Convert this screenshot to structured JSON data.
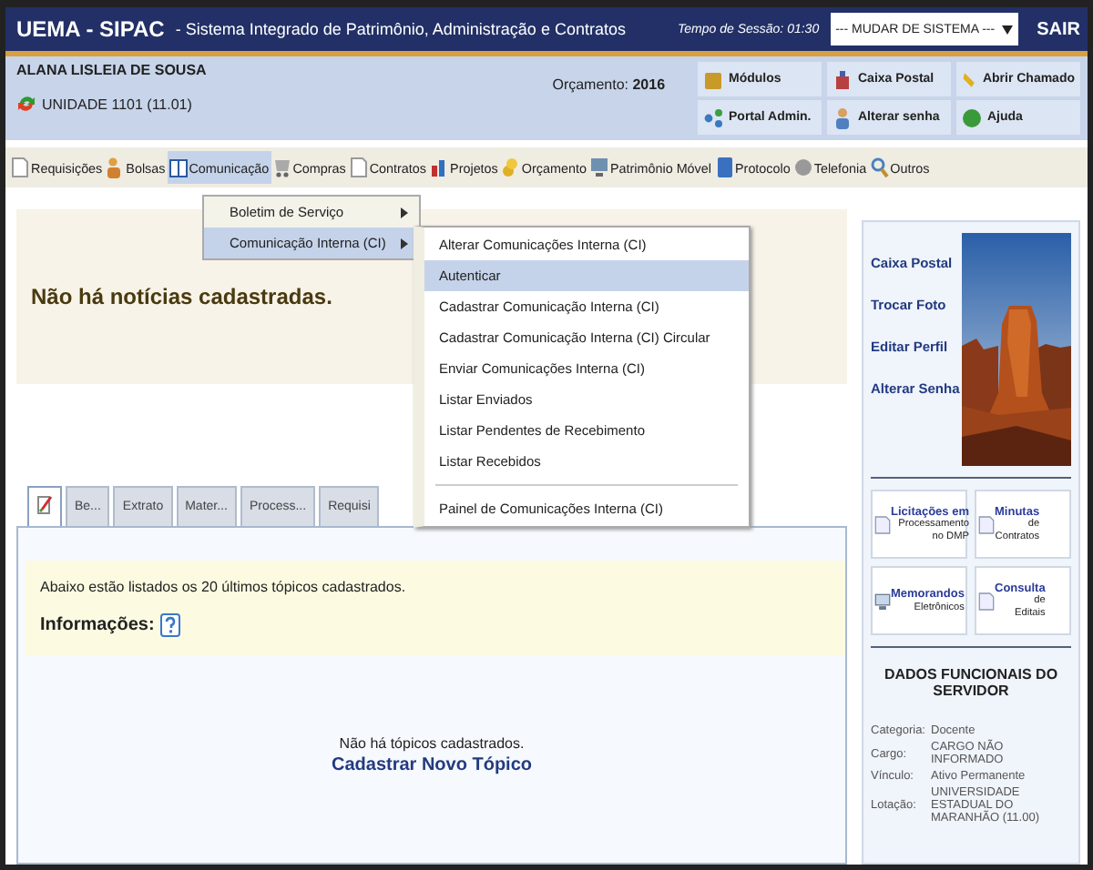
{
  "header": {
    "brand": "UEMA - SIPAC",
    "subtitle": "- Sistema Integrado de Patrimônio, Administração e Contratos",
    "session_label": "Tempo de Sessão:",
    "session_time": "01:30",
    "system_select": "--- MUDAR DE SISTEMA ---",
    "logout": "SAIR"
  },
  "user": {
    "name": "ALANA LISLEIA DE SOUSA",
    "unit": "UNIDADE 1101 (11.01)",
    "budget_label": "Orçamento:",
    "budget_year": "2016"
  },
  "quick_buttons": [
    {
      "label": "Módulos"
    },
    {
      "label": "Caixa Postal"
    },
    {
      "label": "Abrir Chamado"
    },
    {
      "label": "Portal Admin."
    },
    {
      "label": "Alterar senha"
    },
    {
      "label": "Ajuda"
    }
  ],
  "menu": [
    {
      "label": "Requisições",
      "selected": false
    },
    {
      "label": "Bolsas",
      "selected": false
    },
    {
      "label": "Comunicação",
      "selected": true
    },
    {
      "label": "Compras",
      "selected": false
    },
    {
      "label": "Contratos",
      "selected": false
    },
    {
      "label": "Projetos",
      "selected": false
    },
    {
      "label": "Orçamento",
      "selected": false
    },
    {
      "label": "Patrimônio Móvel",
      "selected": false
    },
    {
      "label": "Protocolo",
      "selected": false
    },
    {
      "label": "Telefonia",
      "selected": false
    },
    {
      "label": "Outros",
      "selected": false
    }
  ],
  "dropdown": [
    {
      "label": "Boletim de Serviço",
      "selected": false
    },
    {
      "label": "Comunicação Interna (CI)",
      "selected": true
    }
  ],
  "submenu": [
    {
      "label": "Alterar Comunicações Interna (CI)",
      "selected": false
    },
    {
      "label": "Autenticar",
      "selected": true
    },
    {
      "label": "Cadastrar Comunicação Interna (CI)",
      "selected": false
    },
    {
      "label": "Cadastrar Comunicação Interna (CI) Circular",
      "selected": false
    },
    {
      "label": "Enviar Comunicações Interna (CI)",
      "selected": false
    },
    {
      "label": "Listar Enviados",
      "selected": false
    },
    {
      "label": "Listar Pendentes de Recebimento",
      "selected": false
    },
    {
      "label": "Listar Recebidos",
      "selected": false
    },
    {
      "label": "Painel de Comunicações Interna (CI)",
      "selected": false
    }
  ],
  "news": {
    "empty": "Não há notícias cadastradas."
  },
  "tabs": [
    {
      "selected": true
    },
    {
      "label": "Be...",
      "selected": false
    },
    {
      "label": "Extrato",
      "selected": false
    },
    {
      "label": "Mater...",
      "selected": false
    },
    {
      "label": "Process...",
      "selected": false
    },
    {
      "label": "Requisi",
      "selected": false
    }
  ],
  "forum": {
    "intro": "Abaixo estão listados os 20 últimos tópicos cadastrados.",
    "info_label": "Informações:",
    "empty": "Não há tópicos cadastrados.",
    "new_topic": "Cadastrar Novo Tópico"
  },
  "sidebar": {
    "links": [
      "Caixa Postal",
      "Trocar Foto",
      "Editar Perfil",
      "Alterar Senha"
    ],
    "tiles": [
      {
        "lines": [
          "Licitações em",
          "Processamento",
          "no DMP"
        ]
      },
      {
        "lines": [
          "Minutas",
          "de",
          "Contratos"
        ]
      },
      {
        "lines": [
          "Memorandos",
          "Eletrônicos"
        ]
      },
      {
        "lines": [
          "Consulta",
          "de",
          "Editais"
        ]
      }
    ],
    "section_title": "DADOS FUNCIONAIS DO SERVIDOR",
    "fields": [
      {
        "label": "Categoria:",
        "value": "Docente"
      },
      {
        "label": "Cargo:",
        "value": "CARGO NÃO INFORMADO"
      },
      {
        "label": "Vínculo:",
        "value": "Ativo Permanente"
      },
      {
        "label": "Lotação:",
        "value": "UNIVERSIDADE ESTADUAL DO MARANHÃO (11.00)"
      }
    ]
  }
}
